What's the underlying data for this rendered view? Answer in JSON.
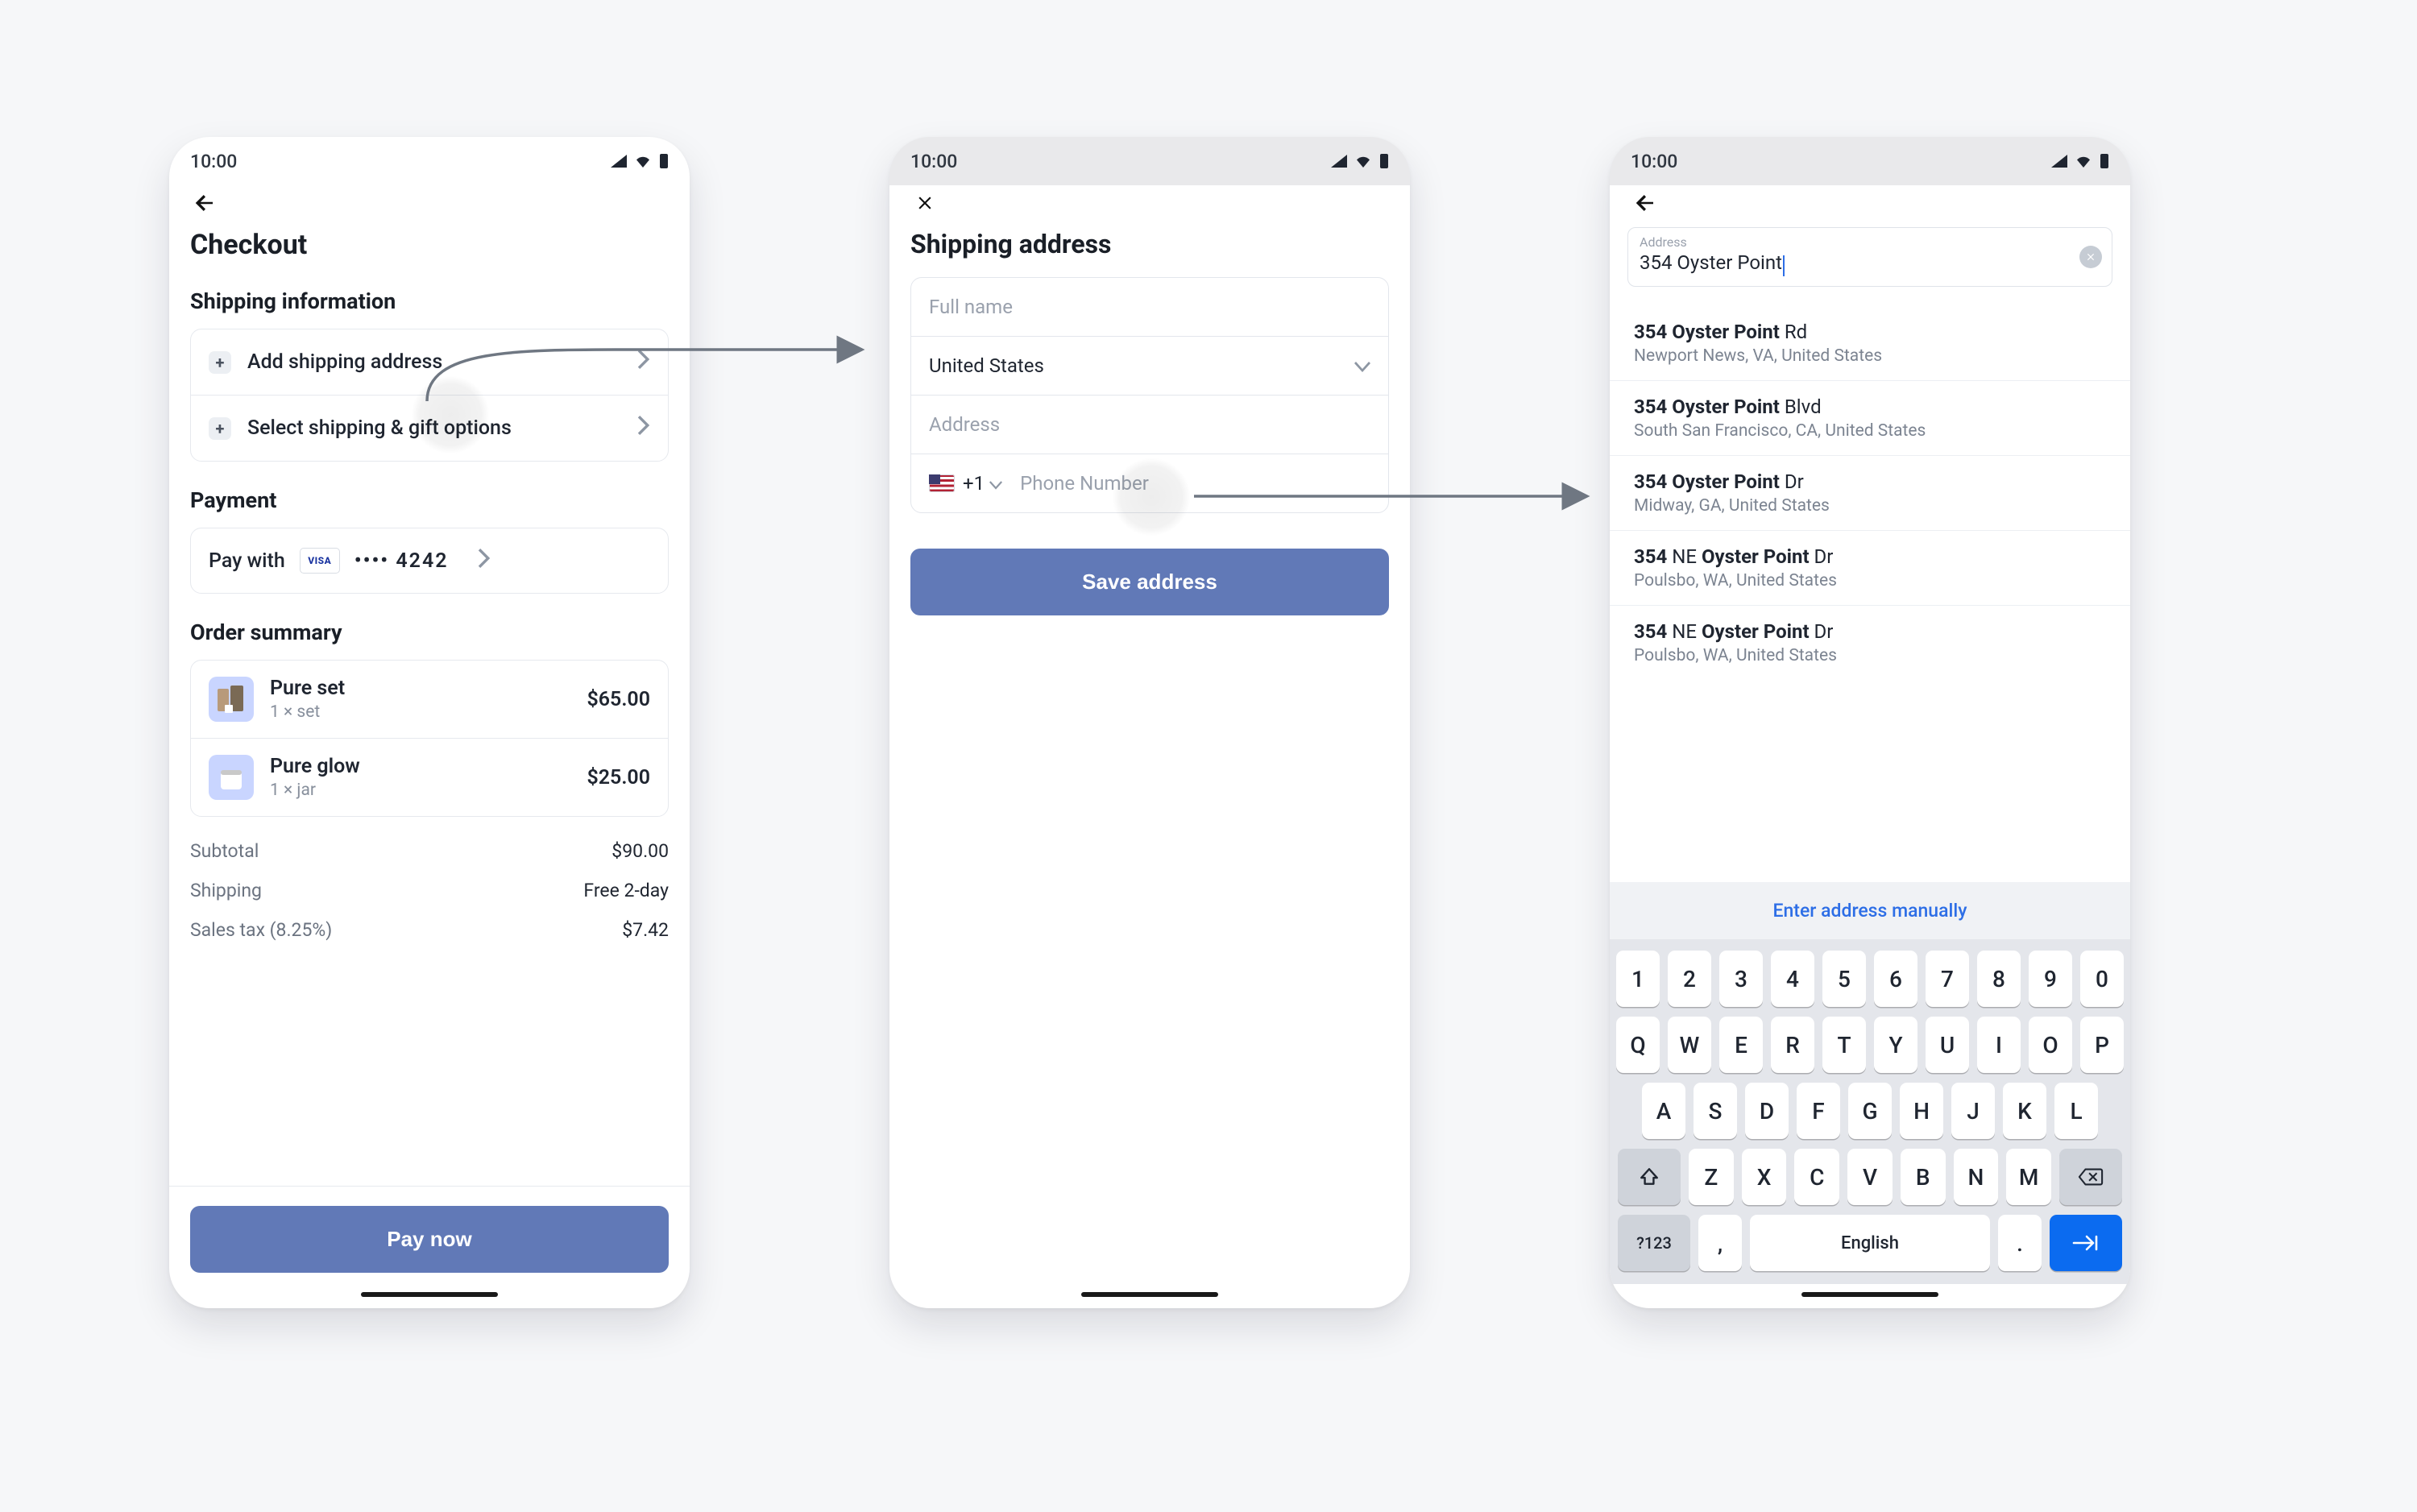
{
  "status_bar": {
    "time": "10:00"
  },
  "colors": {
    "primary": "#6179b7",
    "link": "#2d6ee6"
  },
  "phoneA": {
    "title": "Checkout",
    "sections": {
      "shipping_heading": "Shipping information",
      "payment_heading": "Payment",
      "order_heading": "Order summary"
    },
    "shipping": {
      "add_address": "Add shipping address",
      "select_options": "Select shipping & gift options"
    },
    "payment": {
      "pay_with_label": "Pay with",
      "card_brand": "VISA",
      "card_masked": "•••• 4242"
    },
    "order_items": [
      {
        "name": "Pure set",
        "sub": "1 × set",
        "price": "$65.00"
      },
      {
        "name": "Pure glow",
        "sub": "1 × jar",
        "price": "$25.00"
      }
    ],
    "totals": {
      "subtotal_label": "Subtotal",
      "subtotal_value": "$90.00",
      "shipping_label": "Shipping",
      "shipping_value": "Free 2-day",
      "tax_label": "Sales tax (8.25%)",
      "tax_value": "$7.42"
    },
    "pay_button": "Pay now"
  },
  "phoneB": {
    "title": "Shipping address",
    "fields": {
      "full_name_placeholder": "Full name",
      "country_value": "United States",
      "address_placeholder": "Address",
      "dial_prefix": "+1",
      "phone_placeholder": "Phone Number"
    },
    "save_button": "Save address"
  },
  "phoneC": {
    "search": {
      "float_label": "Address",
      "query": "354 Oyster Point"
    },
    "suggestions": [
      {
        "line1": "354 Oyster Point Rd",
        "match": "354 Oyster Point",
        "line2": "Newport News, VA, United States"
      },
      {
        "line1": "354 Oyster Point Blvd",
        "match": "354 Oyster Point",
        "line2": "South San Francisco, CA, United States"
      },
      {
        "line1": "354 Oyster Point Dr",
        "match": "354 Oyster Point",
        "line2": "Midway, GA, United States"
      },
      {
        "line1": "354 NE Oyster Point Dr",
        "match": "Oyster Point",
        "line2": "Poulsbo, WA, United States"
      },
      {
        "line1": "354 NE Oyster Point Dr",
        "match": "Oyster Point",
        "line2": "Poulsbo, WA, United States"
      }
    ],
    "manual_label": "Enter address manually",
    "keyboard": {
      "row_num": [
        "1",
        "2",
        "3",
        "4",
        "5",
        "6",
        "7",
        "8",
        "9",
        "0"
      ],
      "row1": [
        "Q",
        "W",
        "E",
        "R",
        "T",
        "Y",
        "U",
        "I",
        "O",
        "P"
      ],
      "row2": [
        "A",
        "S",
        "D",
        "F",
        "G",
        "H",
        "J",
        "K",
        "L"
      ],
      "row3": [
        "Z",
        "X",
        "C",
        "V",
        "B",
        "N",
        "M"
      ],
      "mode_label": "?123",
      "space_label": "English"
    }
  }
}
